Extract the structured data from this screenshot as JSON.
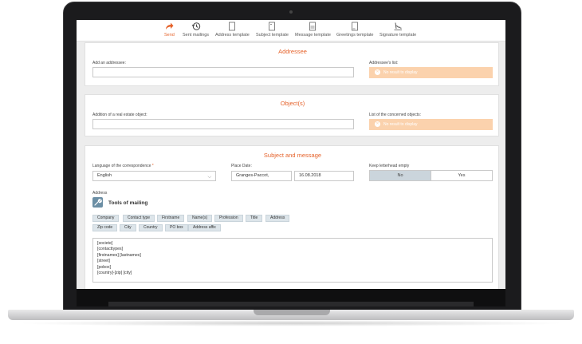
{
  "toolbar": {
    "items": [
      {
        "label": "Send",
        "icon": "send-icon"
      },
      {
        "label": "Sent mailings",
        "icon": "history-icon"
      },
      {
        "label": "Address template",
        "icon": "document-icon"
      },
      {
        "label": "Subject template",
        "icon": "document-icon"
      },
      {
        "label": "Message template",
        "icon": "document-icon"
      },
      {
        "label": "Greetings template",
        "icon": "document-icon"
      },
      {
        "label": "Signature template",
        "icon": "signature-icon"
      }
    ]
  },
  "addressee": {
    "title": "Addressee",
    "add_label": "Add an addressee:",
    "list_label": "Addressee's list:",
    "no_result": "No result to display"
  },
  "objects": {
    "title": "Object(s)",
    "add_label": "Addition of a real estate object:",
    "list_label": "List of the concerned objects:",
    "no_result": "No result to display"
  },
  "subject": {
    "title": "Subject and message",
    "language_label": "Language of the correspondence",
    "language_required": "*",
    "language_value": "English",
    "place_label": "Place Date:",
    "place_value": "Granges-Paccot,",
    "date_value": "16.08.2018",
    "letterhead_label": "Keep letterhead empty",
    "toggle_no": "No",
    "toggle_yes": "Yes",
    "address_label": "Address",
    "tools_title": "Tools of mailing",
    "tags_row1": [
      "Company",
      "Contact type",
      "Firstname",
      "Name(s)",
      "Profession",
      "Title",
      "Address"
    ],
    "tags_row2": [
      "Zip code",
      "City",
      "Country",
      "PO box",
      "Address affix"
    ],
    "address_lines": [
      "[societe]",
      "[contacttypes]",
      "[firstnames] [lastnames]",
      "[street]",
      "[pobox]",
      "[country]-[zip] [city]"
    ]
  },
  "colors": {
    "accent": "#e5622a",
    "no_result_bg": "#fbd2ad",
    "tag_bg": "#dde5ea",
    "toggle_on": "#cbd5dc"
  }
}
